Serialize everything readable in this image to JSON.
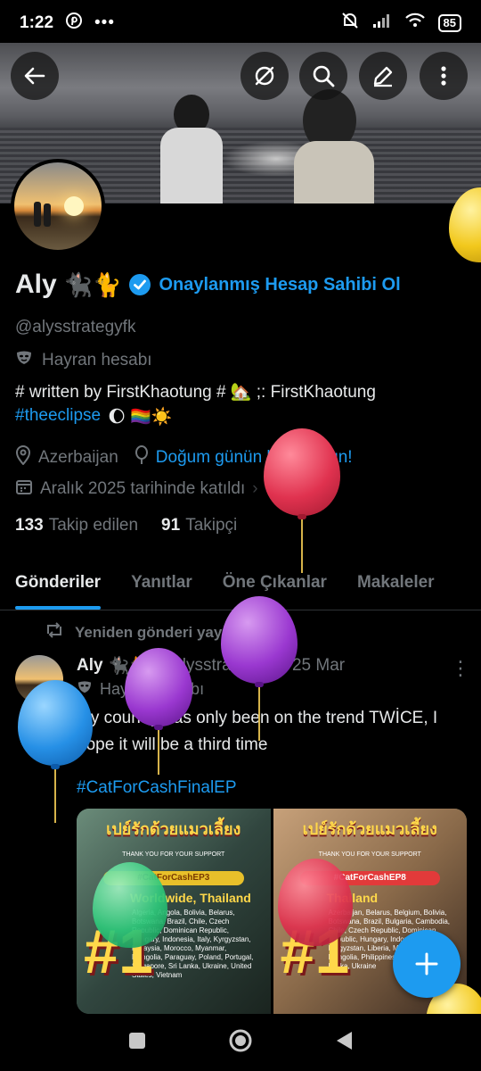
{
  "statusbar": {
    "time": "1:22",
    "battery": "85"
  },
  "profile": {
    "name": "Aly",
    "name_emoji": "🐈‍⬛🐈",
    "verify_link": "Onaylanmış Hesap Sahibi Ol",
    "handle": "@alysstrategyfk",
    "category": "Hayran hesabı",
    "bio_line1": "# written by FirstKhaotung  # 🏡 ;: FirstKhaotung",
    "bio_hashtag": "#theeclipse",
    "bio_emojis": "🌔  🏳️‍🌈☀️",
    "location": "Azerbaijan",
    "birthday_link": "Doğum günün kutlu olsun!",
    "joined": "Aralık 2025 tarihinde katıldı",
    "following_count": "133",
    "following_label": "Takip edilen",
    "followers_count": "91",
    "followers_label": "Takipçi"
  },
  "tabs": [
    {
      "label": "Gönderiler",
      "active": true
    },
    {
      "label": "Yanıtlar",
      "active": false
    },
    {
      "label": "Öne Çıkanlar",
      "active": false
    },
    {
      "label": "Makaleler",
      "active": false
    }
  ],
  "post": {
    "repost_label": "Yeniden gönderi yayınladın",
    "author": "Aly",
    "author_emoji": "🐈‍⬛🐈",
    "handle": "@alysstrategyfk",
    "date": "· 25 Mar",
    "category": "Hayran hesabı",
    "text": "My country has only been on the trend TWİCE, I hope it will be a third time",
    "hashtag": "#CatForCashFinalEP",
    "images": [
      {
        "title": "เปย์รักด้วยแมวเลี้ยง",
        "subtitle": "THANK YOU FOR YOUR SUPPORT",
        "trend_tag": "#CatForCashEP3",
        "heading": "Worldwide, Thailand",
        "countries": "Algeria, Angola, Bolivia, Belarus, Botswana, Brazil, Chile, Czech Republic, Dominican Republic, Hungary, Indonesia, Italy, Kyrgyzstan, Malaysia, Morocco, Myanmar, Mongolia, Paraguay, Poland, Portugal, Singapore, Sri Lanka, Ukraine, United States, Vietnam",
        "rank": "#1"
      },
      {
        "title": "เปย์รักด้วยแมวเลี้ยง",
        "subtitle": "THANK YOU FOR YOUR SUPPORT",
        "trend_tag": "#CatForCashEP8",
        "heading": "Thailand",
        "countries": "Azerbaijan, Belarus, Belgium, Bolivia, Botswana, Brazil, Bulgaria, Cambodia, Chile, Czech Republic, Dominican Republic, Hungary, Indonesia, Kyrgyzstan, Liberia, Malaysia, Mongolia, Philippines, Portugal, Sri Lanka, Ukraine",
        "rank": "#1"
      }
    ]
  },
  "colors": {
    "accent": "#1d9bf0",
    "muted": "#71767b",
    "text": "#e7e9ea",
    "background": "#000000"
  },
  "icons": {
    "back": "back-arrow-icon",
    "hide": "eye-off-icon",
    "search": "search-icon",
    "edit": "pencil-icon",
    "more": "more-vertical-icon",
    "fab": "plus-icon"
  }
}
